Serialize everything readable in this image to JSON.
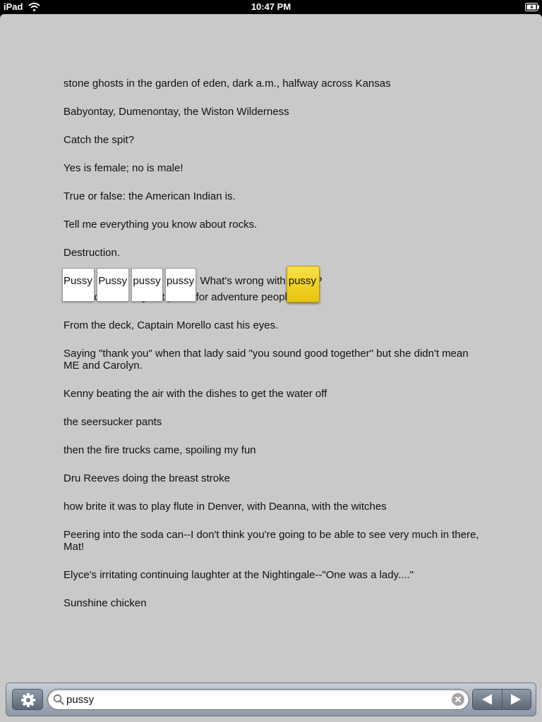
{
  "status_bar": {
    "device": "iPad",
    "time": "10:47 PM"
  },
  "document": {
    "paragraphs": [
      "stone ghosts in the garden of eden, dark a.m., halfway across Kansas",
      "Babyontay, Dumenontay, the Wiston Wilderness",
      "Catch the spit?",
      "Yes is female; no is male!",
      "True or false: the American Indian is.",
      "Tell me everything you know about rocks.",
      "Destruction.",
      "This would be a great place for adventure people!",
      "From the deck, Captain Morello cast his eyes.",
      "Saying \"thank you\" when that lady said \"you sound good together\" but she didn't mean ME and Carolyn.",
      "Kenny beating the air with the dishes to get the water off",
      "the seersucker pants",
      "then the fire trucks came, spoiling my fun",
      "Dru Reeves doing the breast stroke",
      "how brite it was to play flute in Denver, with Deanna, with the witches",
      "Peering into the soda can--I don't think you're going to be able to see very much in there, Mat!",
      "Elyce's irritating continuing laughter at the Nightingale--\"One was a lady....\"",
      "Sunshine chicken"
    ],
    "match_line": {
      "m1": "Pussy",
      "s1": ", ",
      "m2": "Pussy",
      "s2": ", ",
      "m3": "pussy",
      "s3": ", ",
      "m4": "pussy",
      "s4": ". What's wrong with ",
      "m5": "pussy",
      "s5": "?"
    }
  },
  "toolbar": {
    "search_value": "pussy",
    "settings_icon": "gear-icon",
    "prev_icon": "triangle-left-icon",
    "next_icon": "triangle-right-icon",
    "highlight_color": "#f2d22c"
  }
}
